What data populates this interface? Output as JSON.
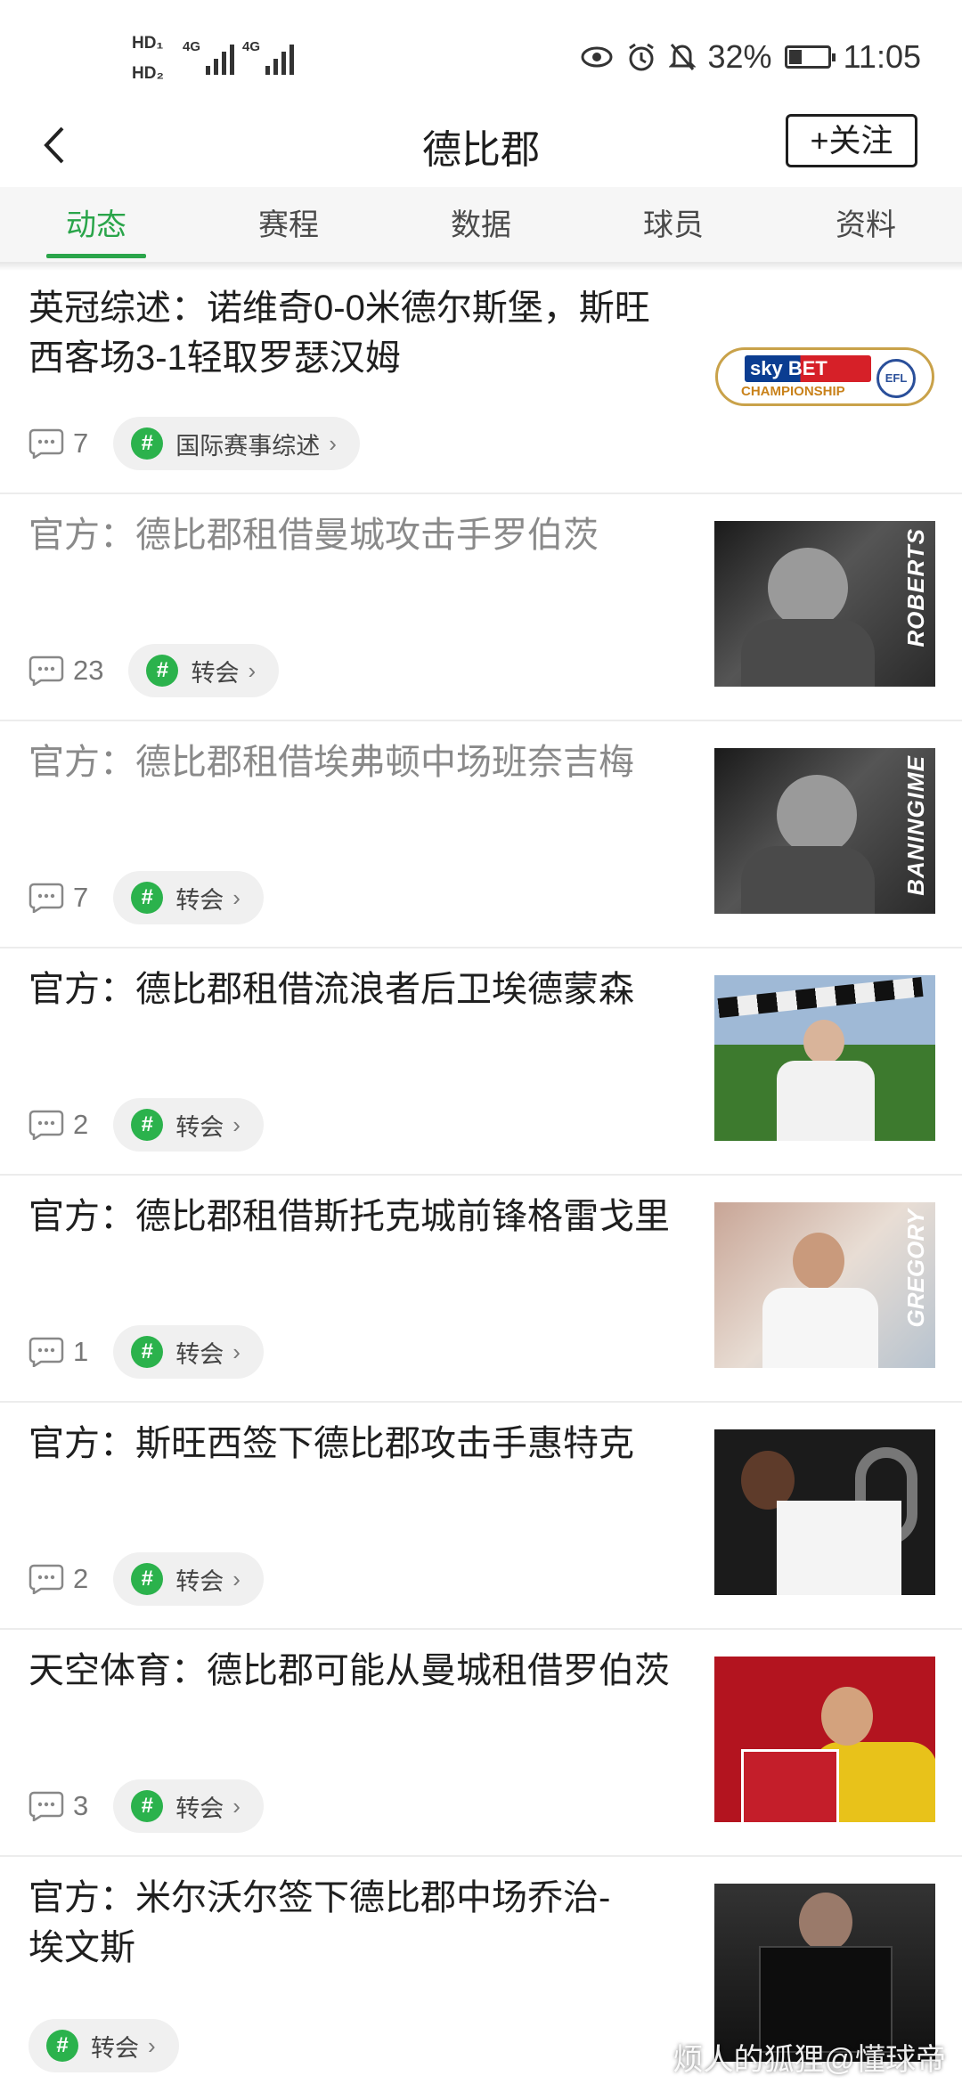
{
  "status_bar": {
    "hd1": "HD₁",
    "hd2": "HD₂",
    "net1": "4G",
    "net2": "4G",
    "battery_percent": "32%",
    "battery_level": 0.32,
    "time": "11:05",
    "icons": [
      "eye-icon",
      "alarm-icon",
      "mute-icon",
      "battery-icon"
    ]
  },
  "header": {
    "title": "德比郡",
    "follow_label": "+关注"
  },
  "tabs": [
    {
      "label": "动态",
      "active": true
    },
    {
      "label": "赛程"
    },
    {
      "label": "数据"
    },
    {
      "label": "球员"
    },
    {
      "label": "资料"
    }
  ],
  "news": [
    {
      "title": "英冠综述：诺维奇0-0米德尔斯堡，斯旺西客场3-1轻取罗瑟汉姆",
      "comments": "7",
      "tag": "国际赛事综述",
      "read": false
    },
    {
      "title": "官方：德比郡租借曼城攻击手罗伯茨",
      "comments": "23",
      "tag": "转会",
      "read": true,
      "thumb_text": "ROBERTS"
    },
    {
      "title": "官方：德比郡租借埃弗顿中场班奈吉梅",
      "comments": "7",
      "tag": "转会",
      "read": true,
      "thumb_text": "BANINGIME"
    },
    {
      "title": "官方：德比郡租借流浪者后卫埃德蒙森",
      "comments": "2",
      "tag": "转会",
      "read": false
    },
    {
      "title": "官方：德比郡租借斯托克城前锋格雷戈里",
      "comments": "1",
      "tag": "转会",
      "read": false,
      "thumb_text": "GREGORY"
    },
    {
      "title": "官方：斯旺西签下德比郡攻击手惠特克",
      "comments": "2",
      "tag": "转会",
      "read": false
    },
    {
      "title": "天空体育：德比郡可能从曼城租借罗伯茨",
      "comments": "3",
      "tag": "转会",
      "read": false
    },
    {
      "title": "官方：米尔沃尔签下德比郡中场乔治-埃文斯",
      "comments": "",
      "tag": "转会",
      "read": false
    }
  ],
  "sky_logo": {
    "sky": "sky BET",
    "champ": "CHAMPIONSHIP",
    "efl": "EFL"
  },
  "watermark": "烦人的狐狸@懂球帝",
  "colors": {
    "accent": "#2aa54a",
    "tag_icon": "#2bb24c"
  }
}
